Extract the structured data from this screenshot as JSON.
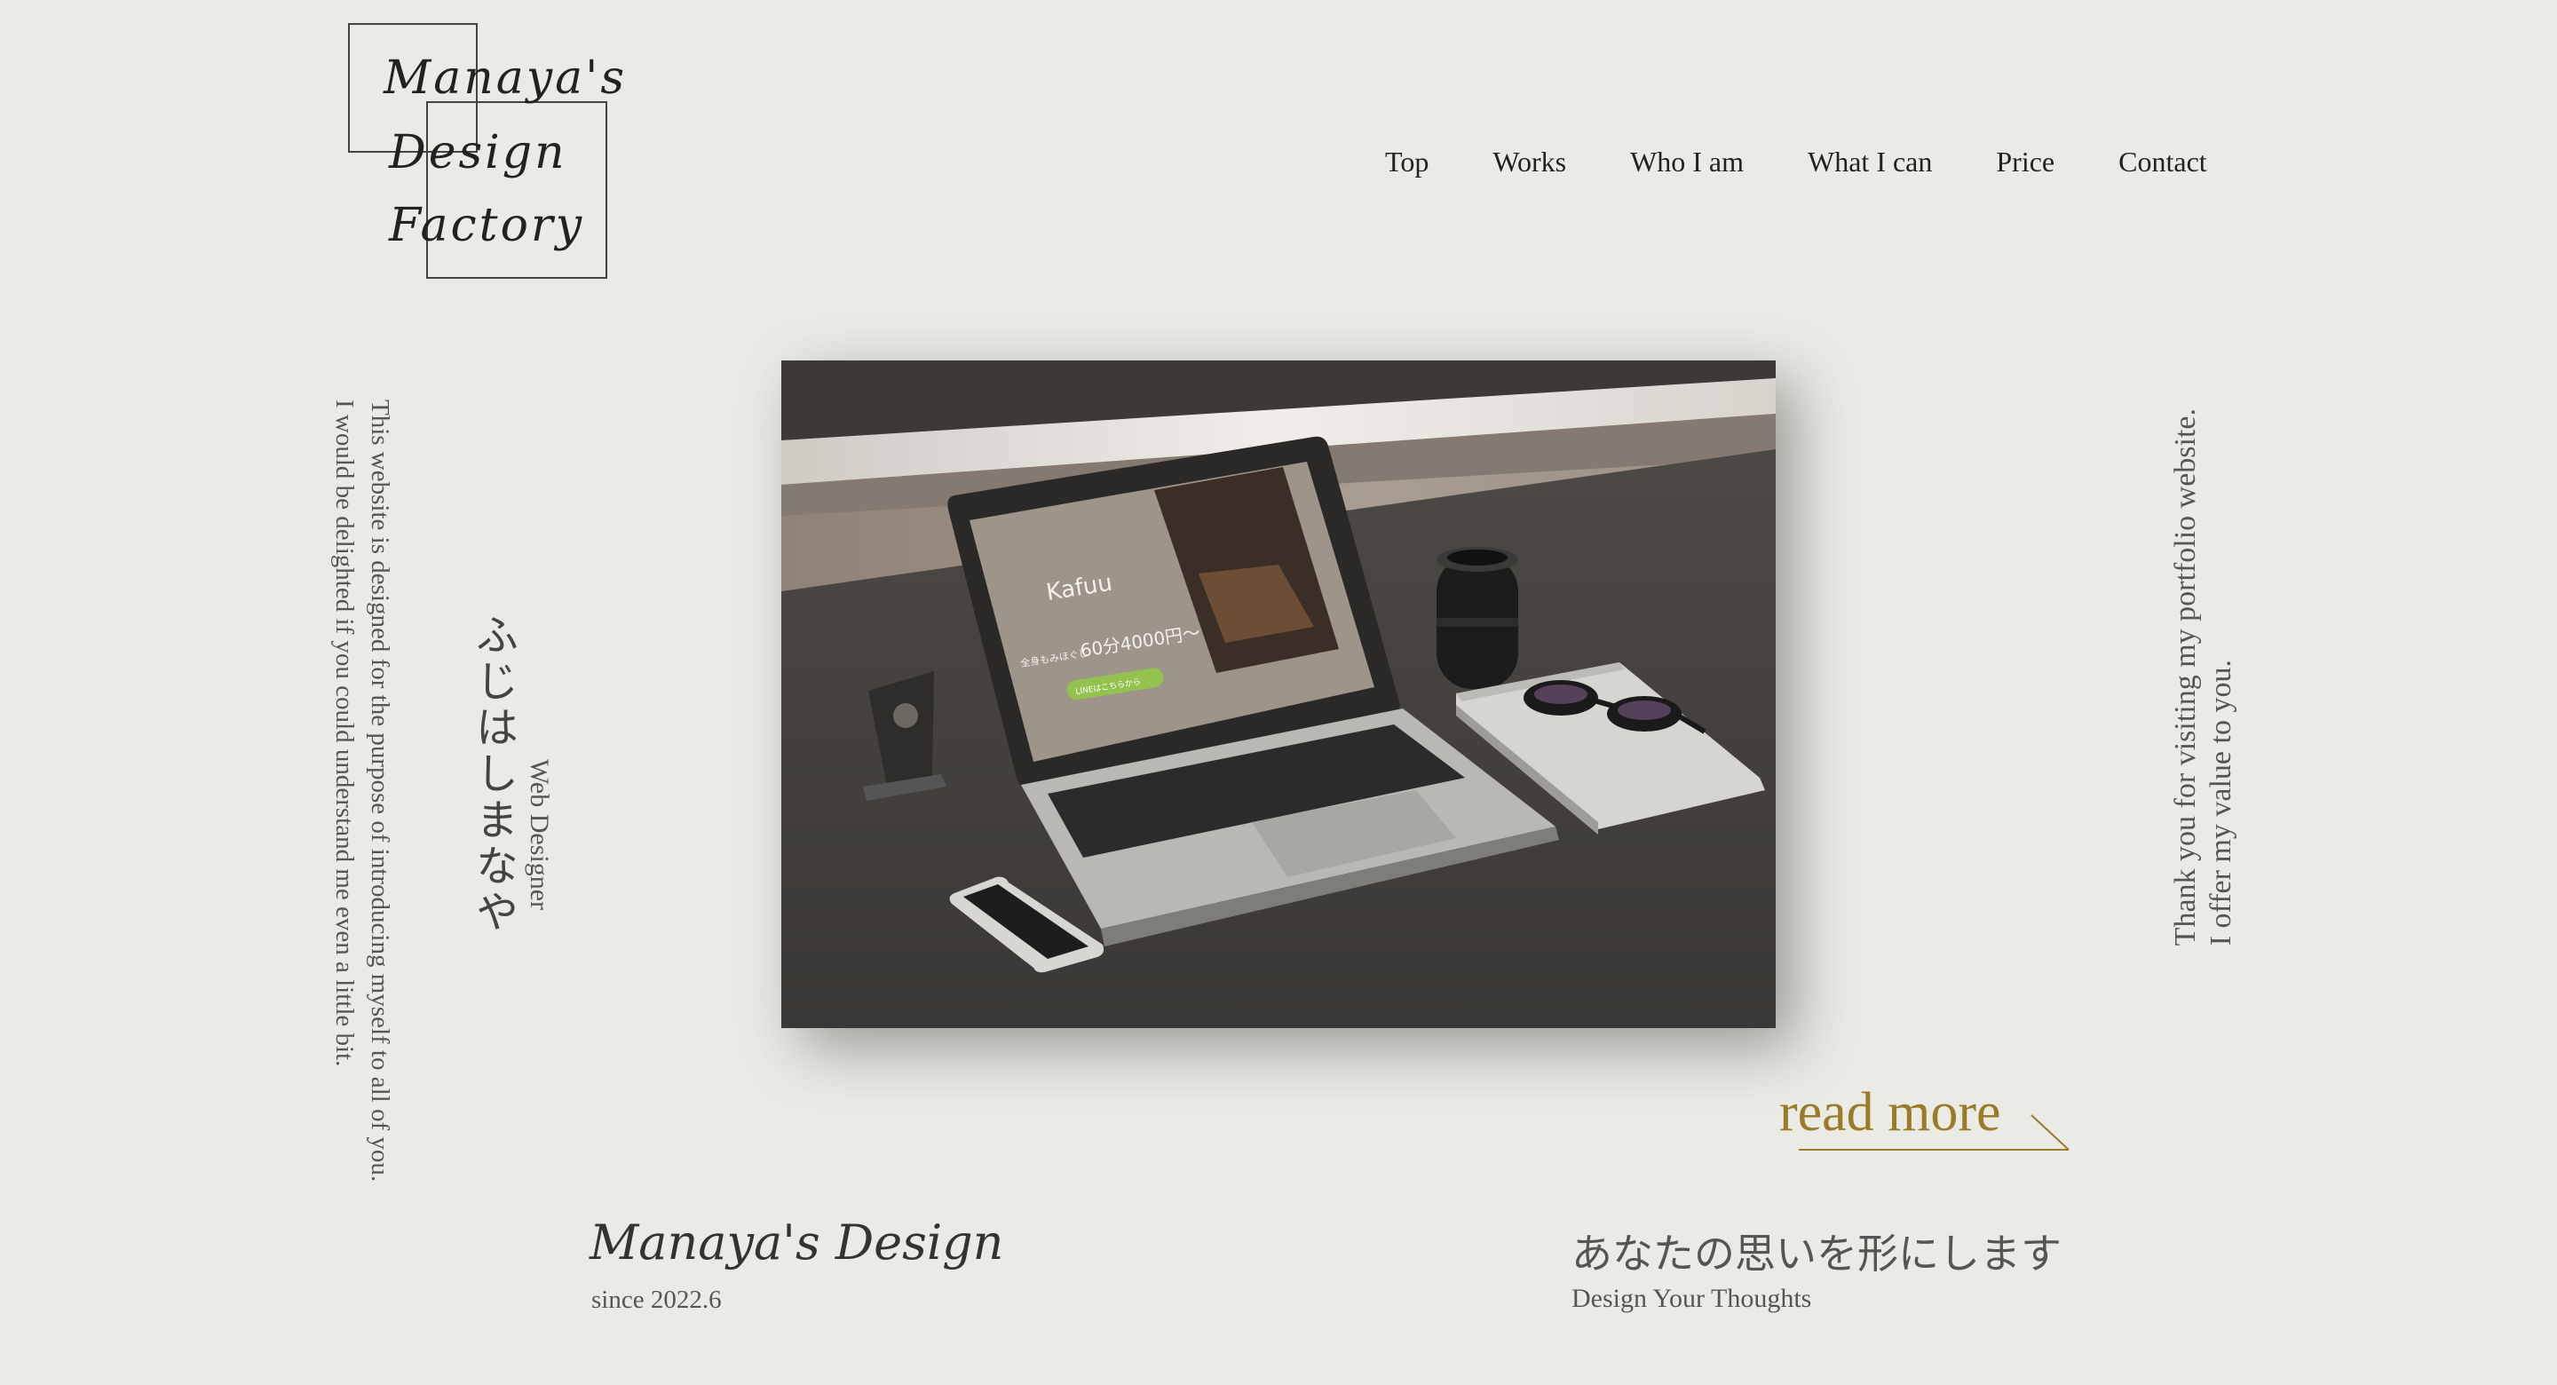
{
  "logo": {
    "line1": "Manaya's",
    "line2": "Design",
    "line3": "Factory"
  },
  "nav": {
    "items": [
      {
        "label": "Top"
      },
      {
        "label": "Works"
      },
      {
        "label": "Who I am"
      },
      {
        "label": "What I can"
      },
      {
        "label": "Price"
      },
      {
        "label": "Contact"
      }
    ]
  },
  "intro": {
    "line1": "This website is designed for the purpose of introducing myself to all of you.",
    "line2": "I would be delighted if you could understand me even a little bit."
  },
  "profile": {
    "name_jp": "ふじはしまなや",
    "role": "Web Designer"
  },
  "hero": {
    "screen_logo": "Kafuu",
    "screen_price": "60分4000円〜",
    "screen_price_prefix": "全身もみほぐし",
    "screen_cta": "LINEはこちらから"
  },
  "thanks": {
    "line1": "Thank you for visiting my portfolio website.",
    "line2": "I offer my value to you."
  },
  "readmore": {
    "label": "read more"
  },
  "footer": {
    "brand": "Manaya's Design",
    "since": "since 2022.6",
    "tagline_jp": "あなたの思いを形にします",
    "tagline_en": "Design Your Thoughts"
  },
  "colors": {
    "background": "#ebebe6",
    "accent": "#9b7a28",
    "text": "#333333"
  }
}
